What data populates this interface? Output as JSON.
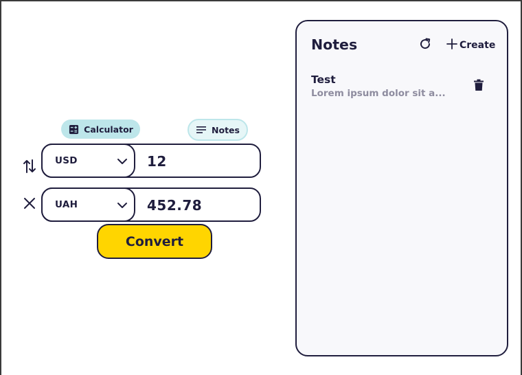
{
  "tabs": {
    "calculator_label": "Calculator",
    "notes_label": "Notes"
  },
  "converter": {
    "from": {
      "currency": "USD",
      "amount": "12"
    },
    "to": {
      "currency": "UAH",
      "amount": "452.78"
    },
    "convert_label": "Convert"
  },
  "notes": {
    "title": "Notes",
    "create_label": "Create",
    "items": [
      {
        "title": "Test",
        "preview": "Lorem ipsum dolor sit a..."
      }
    ]
  },
  "icons": {
    "calculator": "calculator-icon",
    "notes": "notes-icon",
    "swap": "swap-vertical-icon",
    "clear": "close-icon",
    "chevron": "chevron-down-icon",
    "refresh": "refresh-icon",
    "create": "plus-icon",
    "delete": "trash-icon"
  },
  "colors": {
    "primary_text": "#1f1d3d",
    "accent_yellow": "#ffd500",
    "tab_active": "#bde6ea",
    "tab_inactive": "#e6f6f7",
    "panel_bg": "#f8f8fb",
    "muted_text": "#8e8c9f"
  }
}
